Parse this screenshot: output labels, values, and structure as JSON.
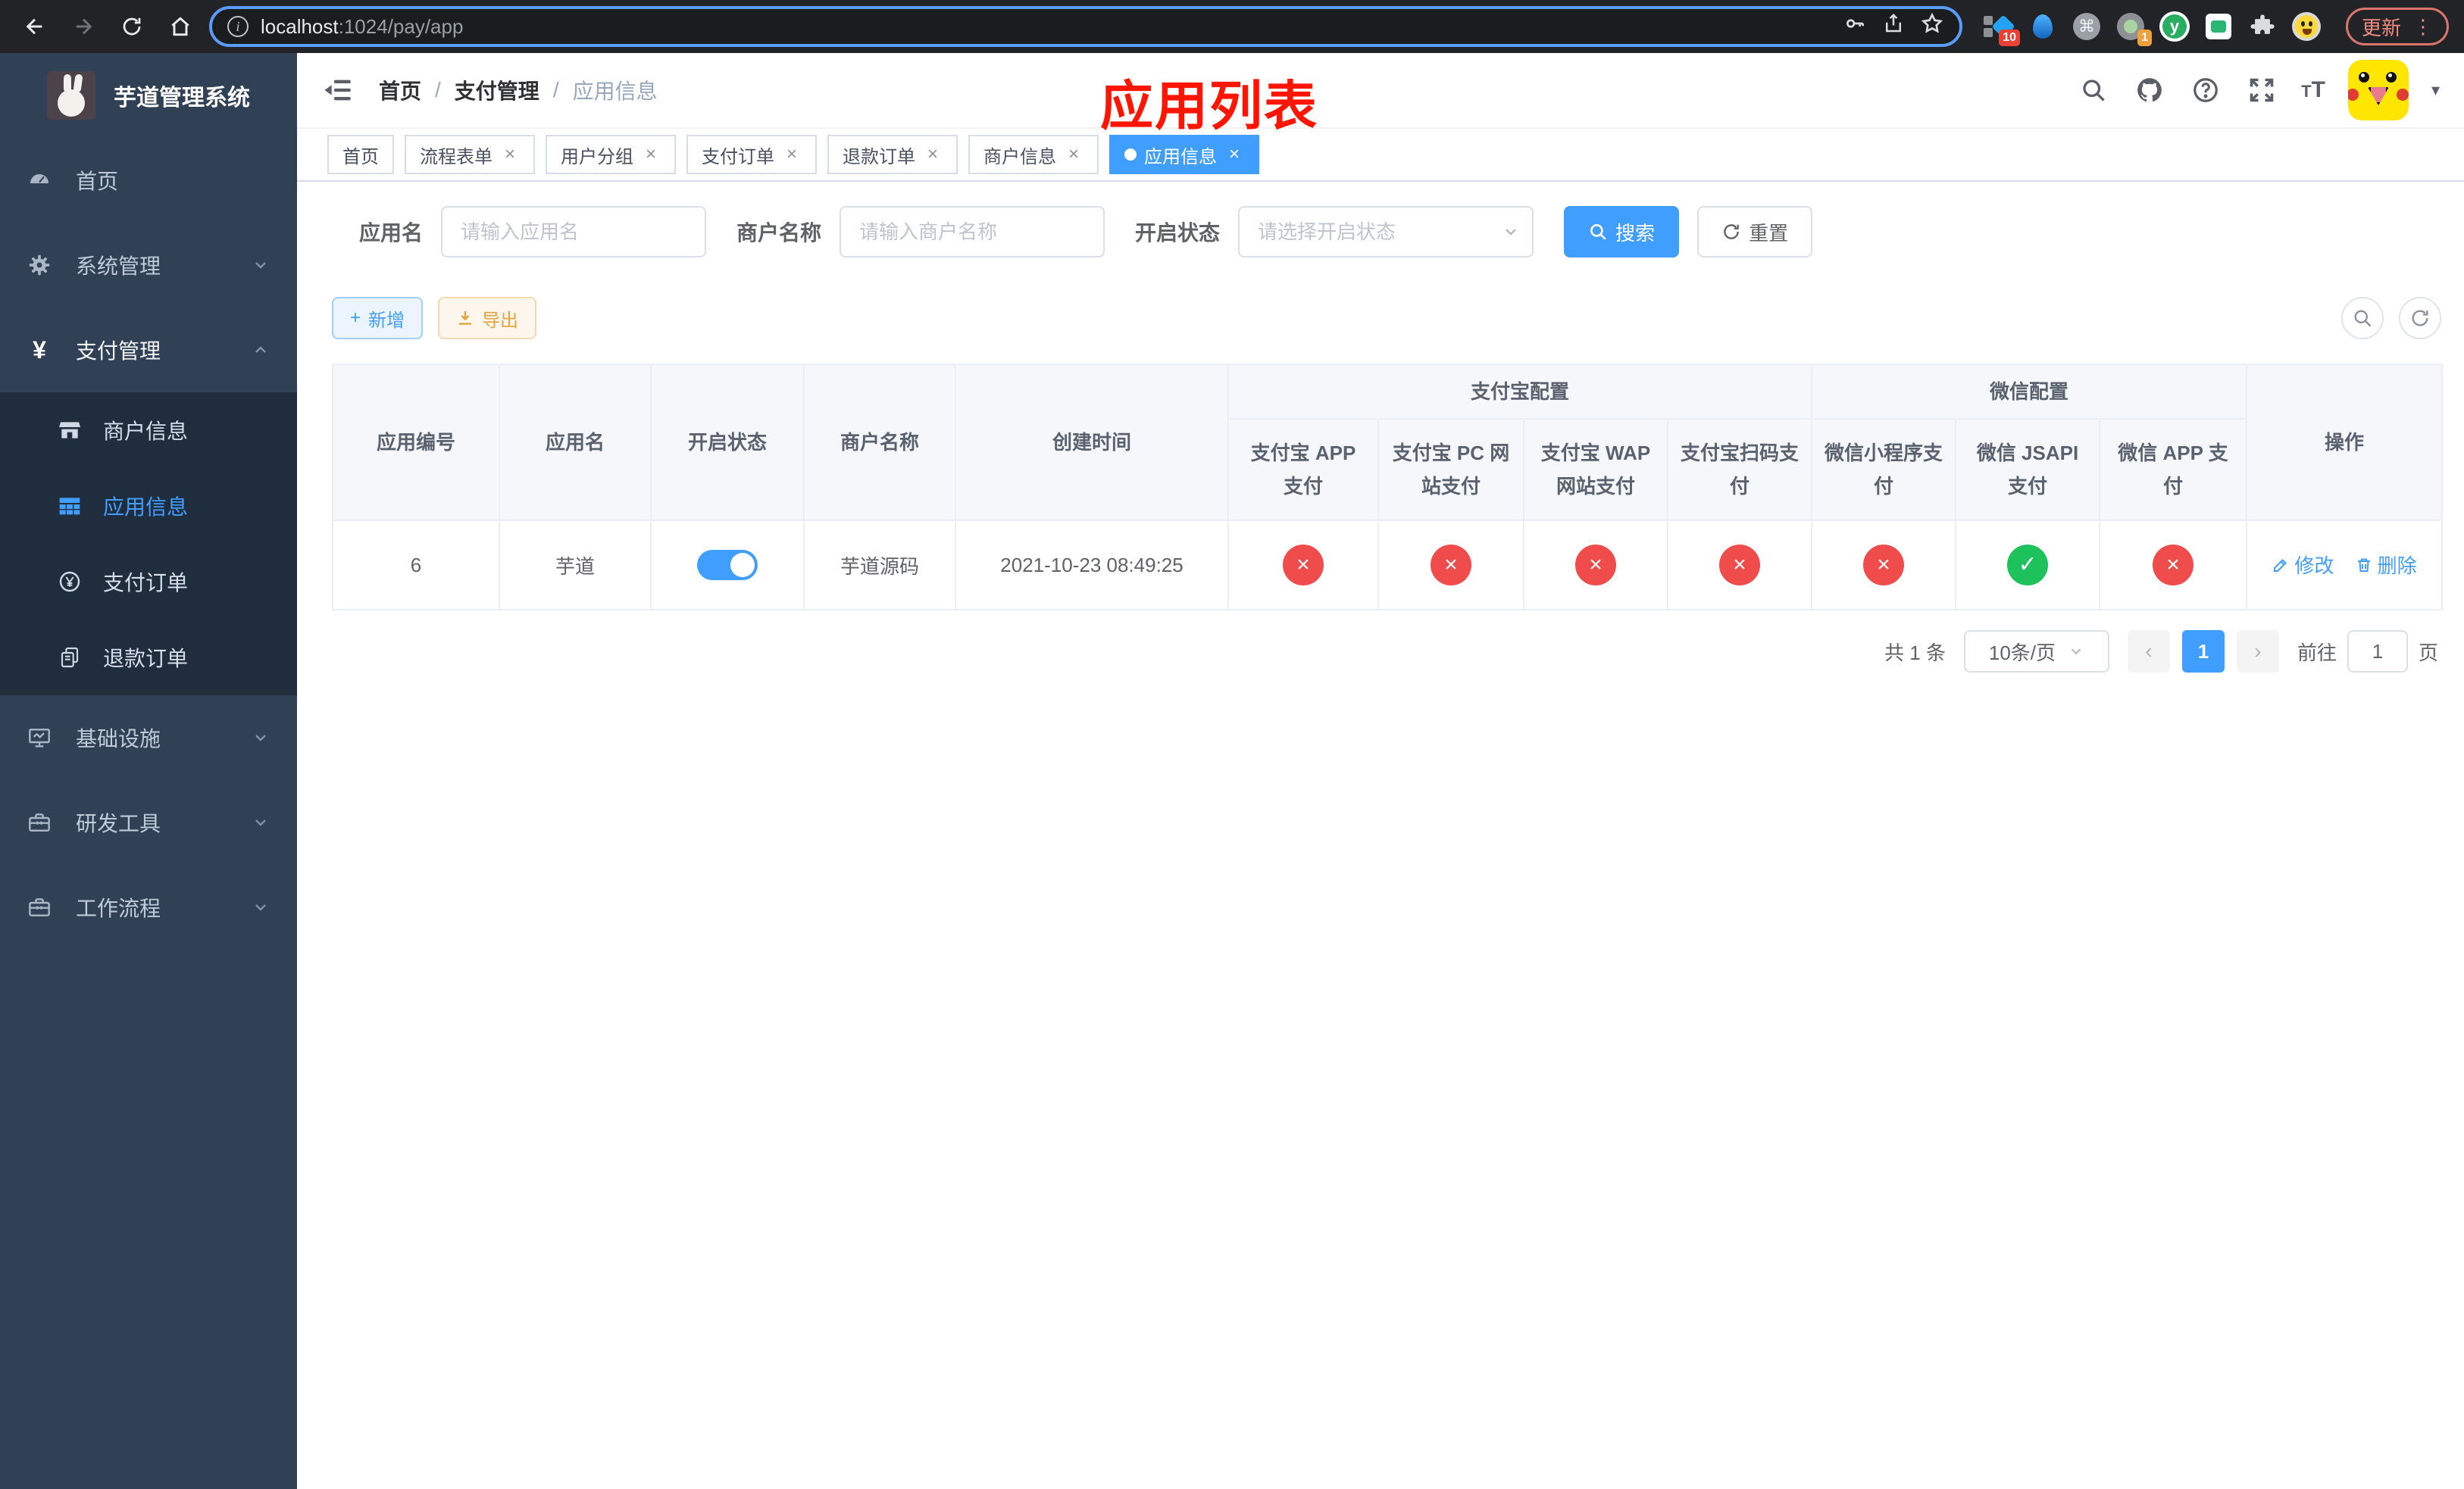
{
  "colors": {
    "primary": "#409eff",
    "success": "#1dc25d",
    "danger": "#f14c4c",
    "warning": "#e6a23c",
    "annotation_red": "#ff1500",
    "sidebar_bg": "#304156",
    "submenu_bg": "#1f2d3d"
  },
  "icons": {
    "close": "×",
    "check": "✓",
    "cross": "×",
    "plus": "+",
    "prev": "‹",
    "next": "›",
    "caret_down": "▾",
    "menu_dots": "⋮",
    "command": "⌘",
    "yen": "¥",
    "y_logo": "y",
    "info": "i",
    "question": "?"
  },
  "browser": {
    "url_host": "localhost",
    "url_rest": ":1024/pay/app",
    "update_label": "更新",
    "ext_badge_blue": "10",
    "ext_badge_grey": "1"
  },
  "sidebar": {
    "title": "芋道管理系统",
    "items": [
      {
        "label": "首页"
      },
      {
        "label": "系统管理"
      },
      {
        "label": "支付管理",
        "children": [
          {
            "label": "商户信息"
          },
          {
            "label": "应用信息"
          },
          {
            "label": "支付订单"
          },
          {
            "label": "退款订单"
          }
        ]
      },
      {
        "label": "基础设施"
      },
      {
        "label": "研发工具"
      },
      {
        "label": "工作流程"
      }
    ]
  },
  "navbar": {
    "breadcrumb": [
      "首页",
      "支付管理",
      "应用信息"
    ],
    "annotation": "应用列表",
    "font_size_small": "T",
    "font_size_big": "T"
  },
  "tabs": [
    {
      "label": "首页"
    },
    {
      "label": "流程表单"
    },
    {
      "label": "用户分组"
    },
    {
      "label": "支付订单"
    },
    {
      "label": "退款订单"
    },
    {
      "label": "商户信息"
    },
    {
      "label": "应用信息"
    }
  ],
  "filters": {
    "app_name_label": "应用名",
    "app_name_placeholder": "请输入应用名",
    "merchant_label": "商户名称",
    "merchant_placeholder": "请输入商户名称",
    "status_label": "开启状态",
    "status_placeholder": "请选择开启状态",
    "search_label": "搜索",
    "reset_label": "重置"
  },
  "toolbar": {
    "add_label": "新增",
    "export_label": "导出"
  },
  "table": {
    "groups": {
      "alipay": "支付宝配置",
      "wechat": "微信配置"
    },
    "columns": {
      "id": "应用编号",
      "name": "应用名",
      "status": "开启状态",
      "merchant": "商户名称",
      "created": "创建时间",
      "op": "操作"
    },
    "pay_columns": [
      "支付宝 APP 支付",
      "支付宝 PC 网站支付",
      "支付宝 WAP 网站支付",
      "支付宝扫码支付",
      "微信小程序支付",
      "微信 JSAPI 支付",
      "微信 APP 支付"
    ],
    "rows": [
      {
        "id": "6",
        "name": "芋道",
        "enabled": true,
        "merchant": "芋道源码",
        "created": "2021-10-23 08:49:25",
        "statuses": [
          "cross",
          "cross",
          "cross",
          "cross",
          "cross",
          "check",
          "cross"
        ]
      }
    ],
    "actions": {
      "edit": "修改",
      "delete": "删除"
    }
  },
  "pagination": {
    "total": "共 1 条",
    "per_page": "10条/页",
    "page": "1",
    "goto_label": "前往",
    "goto_value": "1",
    "page_unit": "页"
  }
}
